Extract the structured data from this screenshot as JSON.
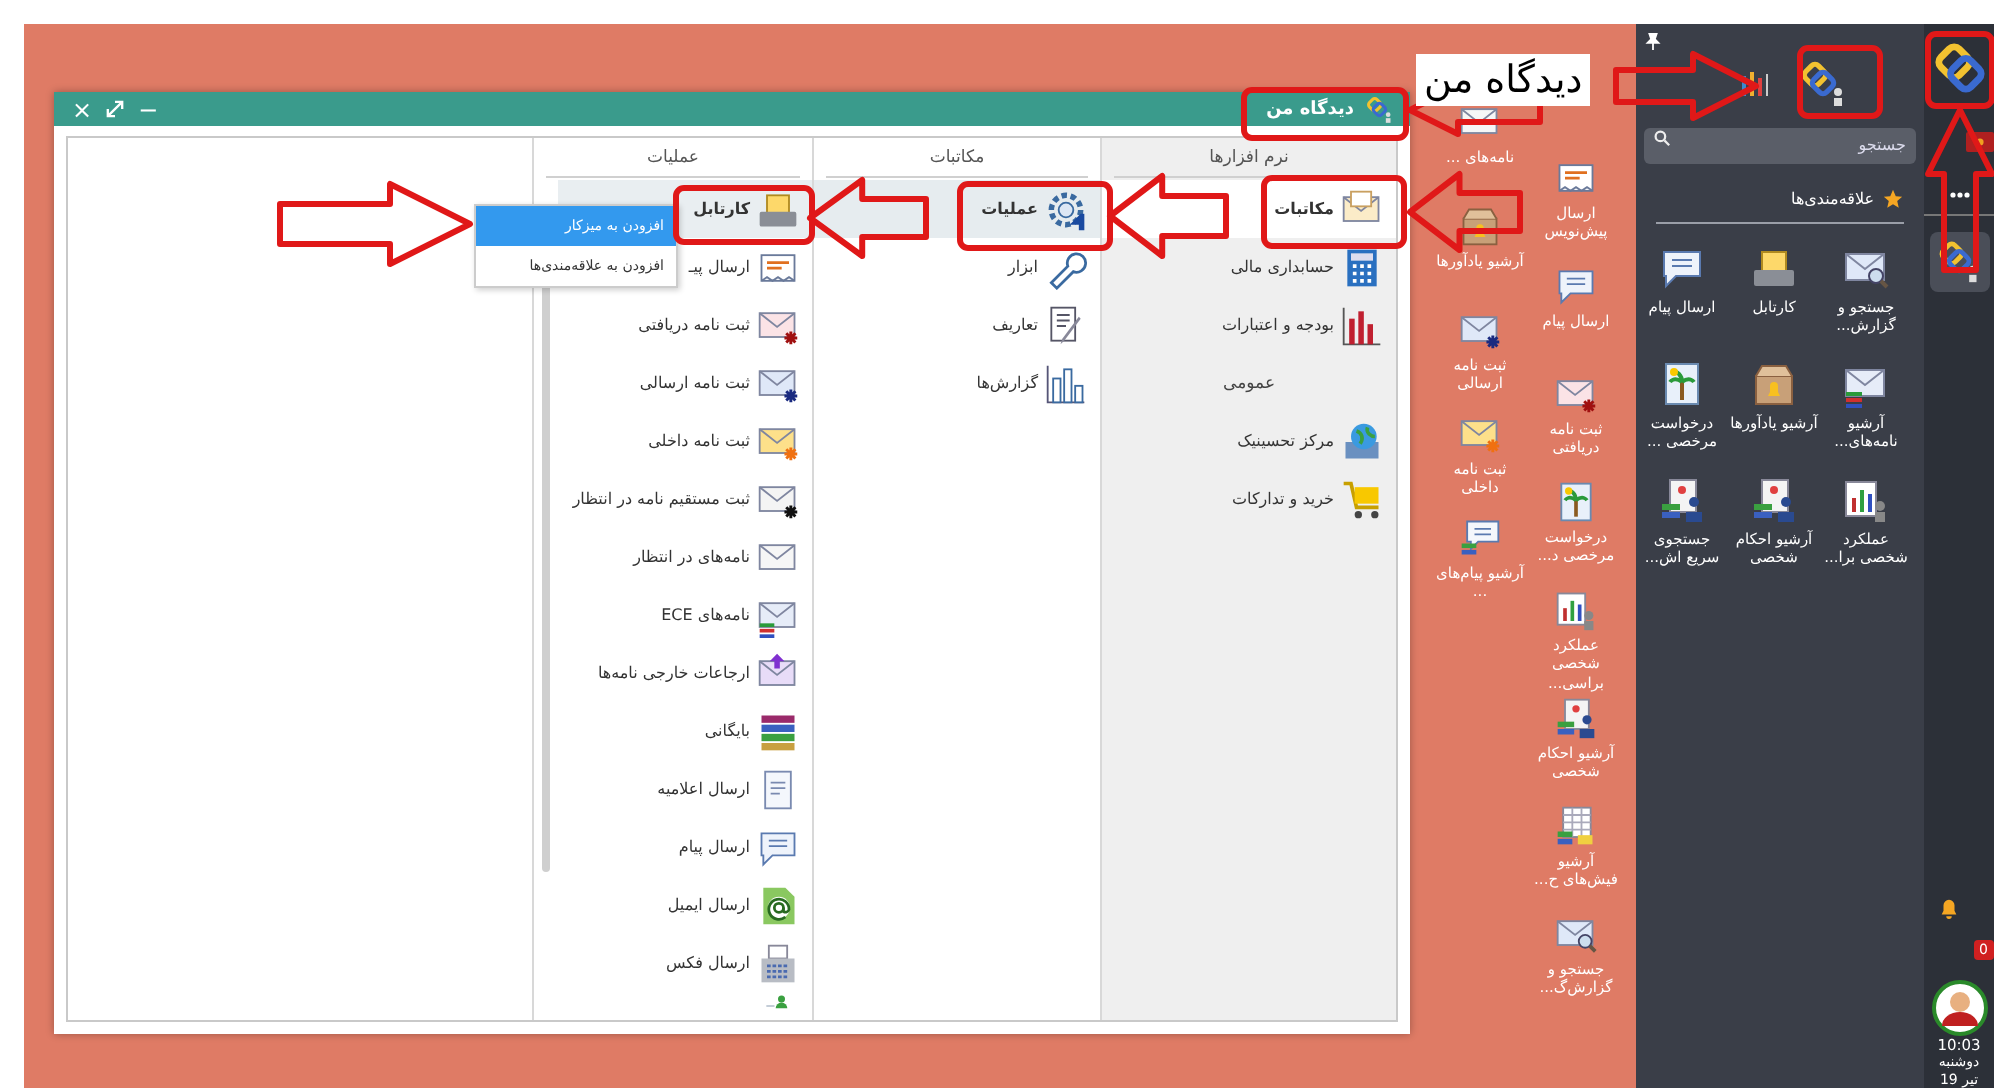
{
  "callout": {
    "text": "دیدگاه من"
  },
  "window": {
    "title": "دیدگاه من",
    "close": "×",
    "minimize": "−"
  },
  "columns": [
    {
      "header": "نرم افزارها",
      "items": [
        {
          "kind": "app",
          "label": "مکاتبات",
          "selected": true
        },
        {
          "kind": "app",
          "label": "حسابداری مالی",
          "selected": false
        },
        {
          "kind": "app",
          "label": "بودجه و اعتبارات",
          "selected": false
        },
        {
          "kind": "group",
          "label": "عمومی"
        },
        {
          "kind": "app",
          "label": "مرکز تحسینیک",
          "selected": false
        },
        {
          "kind": "app",
          "label": "خرید و تدارکات",
          "selected": false
        }
      ]
    },
    {
      "header": "مکاتبات",
      "items": [
        {
          "kind": "app",
          "label": "عملیات",
          "selected": true
        },
        {
          "kind": "app",
          "label": "ابزار",
          "selected": false
        },
        {
          "kind": "app",
          "label": "تعاریف",
          "selected": false
        },
        {
          "kind": "app",
          "label": "گزارش‌ها",
          "selected": false
        }
      ]
    },
    {
      "header": "عملیات",
      "items": [
        {
          "kind": "app",
          "label": "کارتابل",
          "selected": true
        },
        {
          "kind": "app",
          "label": "ارسال پیـ",
          "selected": false
        },
        {
          "kind": "app",
          "label": "ثبت نامه دریافتی",
          "selected": false
        },
        {
          "kind": "app",
          "label": "ثبت نامه ارسالی",
          "selected": false
        },
        {
          "kind": "app",
          "label": "ثبت نامه داخلی",
          "selected": false
        },
        {
          "kind": "app",
          "label": "ثبت مستقیم نامه در انتظار",
          "selected": false
        },
        {
          "kind": "app",
          "label": "نامه‌های در انتظار",
          "selected": false
        },
        {
          "kind": "app",
          "label": "نامه‌های ECE",
          "selected": false
        },
        {
          "kind": "app",
          "label": "ارجاعات خارجی نامه‌ها",
          "selected": false
        },
        {
          "kind": "app",
          "label": "بایگانی",
          "selected": false
        },
        {
          "kind": "app",
          "label": "ارسال اعلامیه",
          "selected": false
        },
        {
          "kind": "app",
          "label": "ارسال پیام",
          "selected": false
        },
        {
          "kind": "app",
          "label": "ارسال ایمیل",
          "selected": false
        },
        {
          "kind": "app",
          "label": "ارسال فکس",
          "selected": false
        }
      ]
    }
  ],
  "context_menu": {
    "items": [
      {
        "label": "افزودن به میزکار",
        "selected": true
      },
      {
        "label": "افزودن به علاقه‌مندی‌ها",
        "selected": false
      }
    ]
  },
  "desktop_icons": {
    "column_1": [
      "ارسال پیش‌نویس",
      "ارسال پیام",
      "ثبت نامه دریافتی",
      "درخواست مرخصی د...",
      "عملکرد شخصی براسی...",
      "آرشیو احکام شخصی",
      "آرشیو فیش‌های ح...",
      "جستجو و گزارش‌گ..."
    ],
    "column_2": [
      "نامه‌های ...",
      "آرشیو یادآورها",
      "ثبت نامه ارسالی",
      "ثبت نامه داخلی",
      "آرشیو پیام‌های ..."
    ]
  },
  "panel": {
    "search": {
      "placeholder": "جستجو"
    },
    "favorites": {
      "title": "علاقه‌مندی‌ها",
      "items": [
        "جستجو و گزارش...",
        "کارتابل",
        "ارسال پیام",
        "آرشیو نامه‌های...",
        "آرشیو یادآورها",
        "درخواست مرخصی ...",
        "عملکرد شخصی برا...",
        "آرشیو احکام شخصی",
        "جستجوی سریع اش..."
      ]
    }
  },
  "taskbar": {
    "badge": "0",
    "time": "10:03",
    "day": "دوشنبه",
    "date": "19 تیر"
  }
}
